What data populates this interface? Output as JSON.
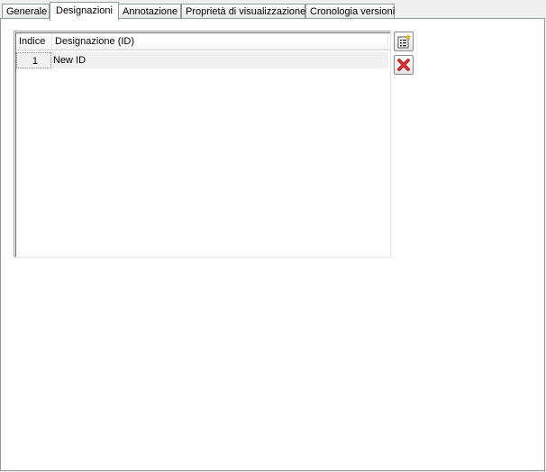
{
  "tabs": [
    {
      "label": "Generale"
    },
    {
      "label": "Designazioni",
      "active": true
    },
    {
      "label": "Annotazione"
    },
    {
      "label": "Proprietà di visualizzazione"
    },
    {
      "label": "Cronologia versioni"
    }
  ],
  "designations": {
    "columns": {
      "index": "Indice",
      "designation": "Designazione (ID)"
    },
    "rows": [
      {
        "index": "1",
        "designation": "New ID"
      }
    ]
  },
  "actions": {
    "add_icon": "new-item-icon",
    "delete_icon": "delete-x-icon"
  }
}
